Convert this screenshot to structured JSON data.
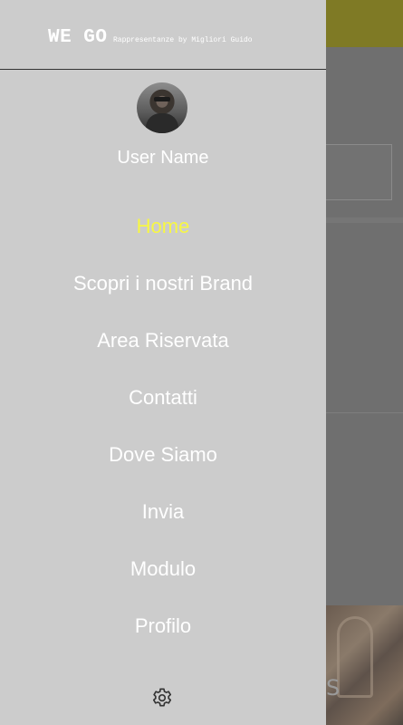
{
  "brand": {
    "name": "WE GO",
    "tagline": "Rappresentanze by Migliori Guido"
  },
  "user": {
    "name": "User Name"
  },
  "menu": {
    "items": [
      {
        "label": "Home",
        "active": true
      },
      {
        "label": "Scopri i nostri Brand"
      },
      {
        "label": "Area Riservata"
      },
      {
        "label": "Contatti"
      },
      {
        "label": "Dove Siamo"
      },
      {
        "label": "Invia"
      },
      {
        "label": "Modulo"
      },
      {
        "label": "Profilo"
      }
    ]
  },
  "icons": {
    "settings": "gear-icon",
    "avatar": "user-avatar"
  },
  "colors": {
    "drawer_bg": "#cccccc",
    "active_item": "#f7f743",
    "topbar": "#7f7a25"
  }
}
